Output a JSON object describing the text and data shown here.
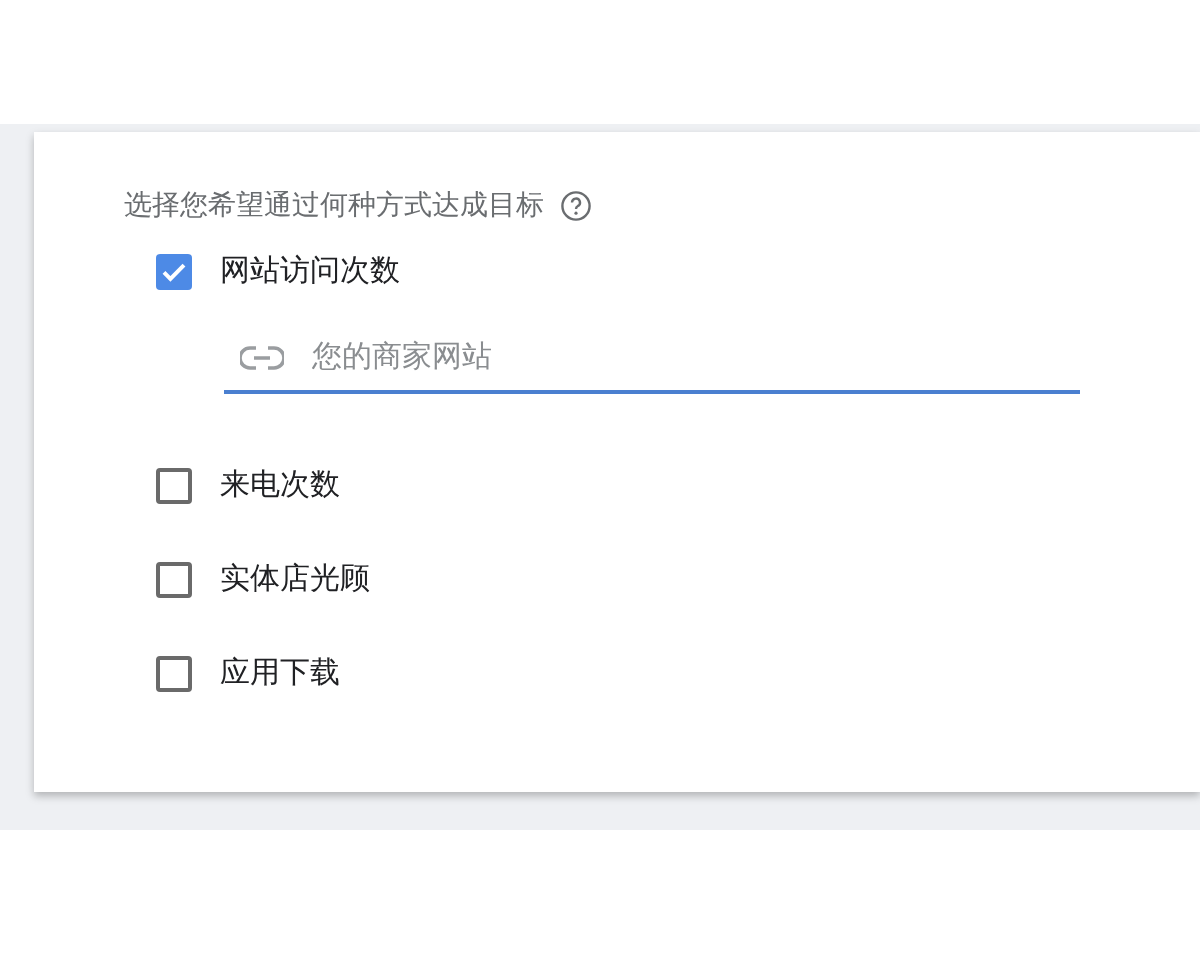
{
  "prompt": {
    "text": "选择您希望通过何种方式达成目标"
  },
  "options": [
    {
      "label": "网站访问次数",
      "checked": true,
      "field": {
        "placeholder": "您的商家网站"
      }
    },
    {
      "label": "来电次数",
      "checked": false
    },
    {
      "label": "实体店光顾",
      "checked": false
    },
    {
      "label": "应用下载",
      "checked": false
    }
  ]
}
